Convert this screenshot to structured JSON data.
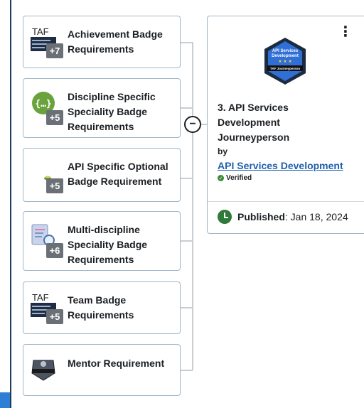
{
  "cards": [
    {
      "title": "Achievement Badge Requirements",
      "count": "+7",
      "icon": "taf-logo-icon",
      "icon_text": "TAF"
    },
    {
      "title": "Discipline Specific Speciality Badge Requirements",
      "count": "+5",
      "icon": "code-braces-icon"
    },
    {
      "title": "API Specific Optional Badge Requirement",
      "count": "+5",
      "icon": "small-badge-icon"
    },
    {
      "title": "Multi-discipline Speciality Badge Requirements",
      "count": "+6",
      "icon": "document-magnifier-icon"
    },
    {
      "title": "Team Badge Requirements",
      "count": "+5",
      "icon": "taf-logo-icon",
      "icon_text": "TAF"
    },
    {
      "title": "Mentor Requirement",
      "count": "",
      "icon": "mentor-badge-icon"
    }
  ],
  "connector": {
    "collapse_symbol": "−"
  },
  "detail": {
    "kebab": "⋮",
    "title": "3. API Services Development Journeyperson",
    "by": "by",
    "link": "API Services Development",
    "verified": "Verified",
    "published_label": "Published",
    "published_date": ": Jan 18, 2024",
    "badge_lines": [
      "API Services",
      "Development",
      "TAF Journeyperson"
    ]
  },
  "colors": {
    "accent_link": "#1f5fae",
    "verified": "#3b8a3b",
    "border": "#9fb6cc"
  }
}
